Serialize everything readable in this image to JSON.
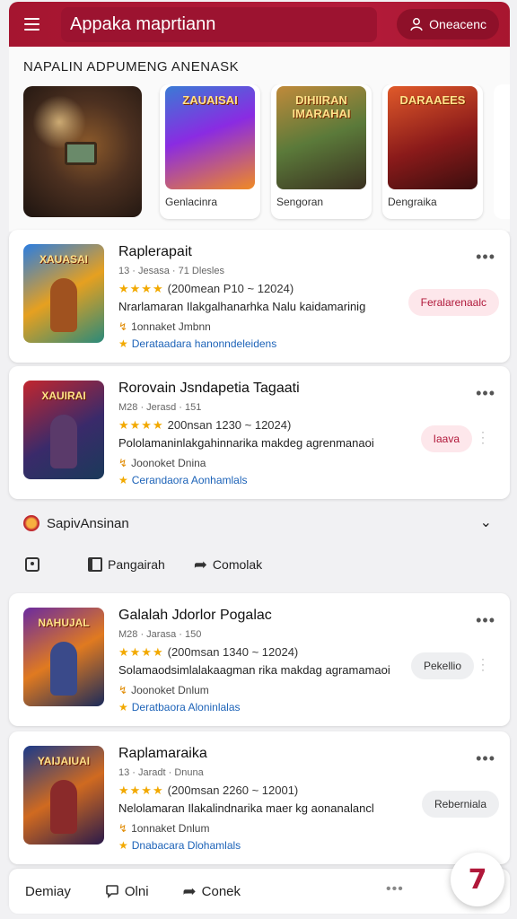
{
  "header": {
    "title": "Appaka maprtiann",
    "menu_icon": "hamburger-menu-icon",
    "action_label": "Oneacenc",
    "action_icon": "user-icon"
  },
  "featured": {
    "section_title": "NAPALIN ADPUMENG ANENASK",
    "cards": [
      {
        "art_title": "ZAUAISAI",
        "label": "Genlacinra"
      },
      {
        "art_title": "DIHIIRAN IMARAHAI",
        "label": "Sengoran"
      },
      {
        "art_title": "DARAAEES",
        "label": "Dengraika"
      }
    ]
  },
  "list": [
    {
      "thumb_title": "XAUASAI",
      "title": "Raplerapait",
      "subtitle": "13 · Jesasa · 71 Dlesles",
      "rating_text": "(200mean P10 ~ 12024)",
      "description": "Nrarlamaran Ilakgalhanarhka Nalu kaidamarinig",
      "developer": "1onnaket Jmbnn",
      "category": "Derataadara hanonndeleidens",
      "button": "Feralarenaalc",
      "button_style": "red"
    },
    {
      "thumb_title": "XAUIRAI",
      "title": "Rorovain Jsndapetia Tagaati",
      "subtitle": "M28 · Jerasd · 151",
      "rating_text": "200nsan 1230 ~ 12024)",
      "description": "Pololamaninlakgahinnarika makdeg agrenmanaoi",
      "developer": "Joonoket Dnina",
      "category": "Cerandaora Aonhamlals",
      "button": "Iaava",
      "button_style": "red"
    },
    {
      "thumb_title": "NAHUJAL",
      "title": "Galalah Jdorlor Pogalac",
      "subtitle": "M28 · Jarasa · 150",
      "rating_text": "(200msan 1340 ~ 12024)",
      "description": "Solamaodsimlalakaagman rika makdag agramamaoi",
      "developer": "Joonoket Dnlum",
      "category": "Deratbaora Aloninlalas",
      "button": "Pekellio",
      "button_style": "gray"
    },
    {
      "thumb_title": "YAIJAIUAI",
      "title": "Raplamaraika",
      "subtitle": "13 · Jaradt · Dnuna",
      "rating_text": "(200msan 2260 ~ 12001)",
      "description": "Nelolamaran Ilakalindnarika maer kg aonanalancl",
      "developer": "1onnaket Dnlum",
      "category": "Dnabacara Dlohamlals",
      "button": "Reberniala",
      "button_style": "gray"
    }
  ],
  "accordion": {
    "label": "SapivAnsinan",
    "icon": "badge-icon",
    "chevron": "chevron-down-icon"
  },
  "actions": [
    {
      "label": "",
      "icon": "home-icon"
    },
    {
      "label": "Pangairah",
      "icon": "book-icon"
    },
    {
      "label": "Comolak",
      "icon": "share-icon"
    }
  ],
  "bottom_bar": {
    "items": [
      {
        "label": "Demiay",
        "icon": ""
      },
      {
        "label": "Olni",
        "icon": "chat-icon"
      },
      {
        "label": "Conek",
        "icon": "share-icon"
      }
    ],
    "more_icon": "more-dots-icon"
  },
  "fab": {
    "glyph": "7",
    "icon": "brand-fab-icon"
  },
  "colors": {
    "brand": "#b31b3a",
    "star": "#f2a900",
    "link": "#1d63b8"
  }
}
